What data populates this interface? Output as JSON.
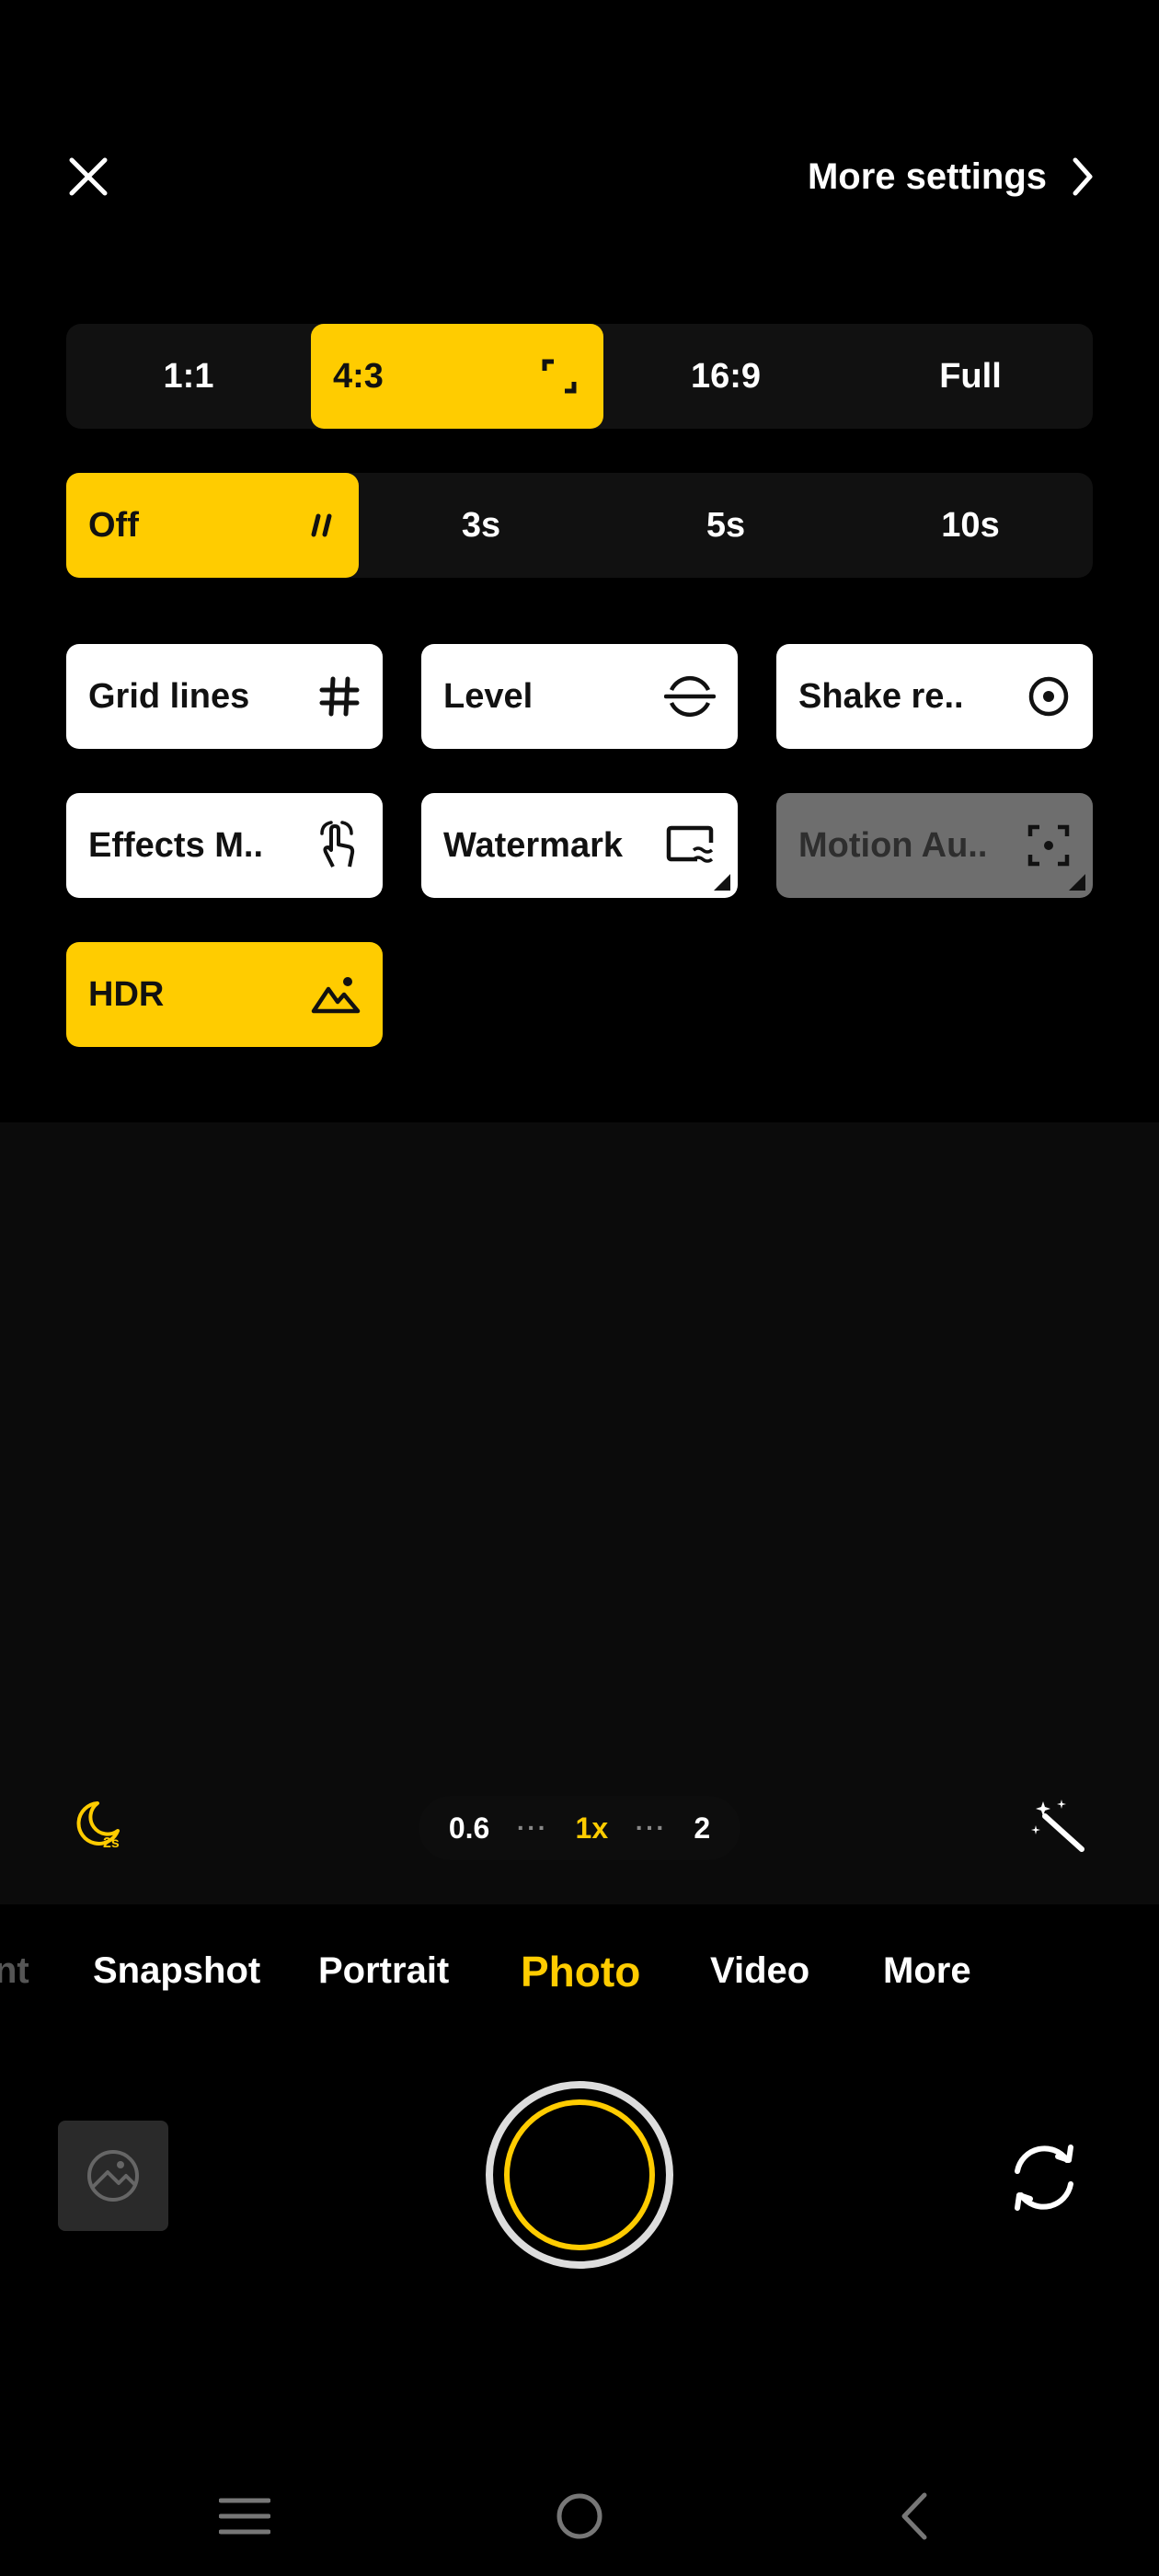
{
  "header": {
    "close_icon": "close-icon",
    "more_settings_label": "More settings",
    "chevron_icon": "chevron-right-icon"
  },
  "aspect_ratio": {
    "options": [
      "1:1",
      "4:3",
      "16:9",
      "Full"
    ],
    "selected": "4:3"
  },
  "timer": {
    "options": [
      "Off",
      "3s",
      "5s",
      "10s"
    ],
    "selected": "Off"
  },
  "toggles": [
    {
      "label": "Grid lines",
      "icon": "grid-icon",
      "state": "off"
    },
    {
      "label": "Level",
      "icon": "level-icon",
      "state": "off"
    },
    {
      "label": "Shake re..",
      "icon": "shake-reduction-icon",
      "state": "off"
    },
    {
      "label": "Effects M..",
      "icon": "gesture-icon",
      "state": "off"
    },
    {
      "label": "Watermark",
      "icon": "watermark-icon",
      "state": "off"
    },
    {
      "label": "Motion Au..",
      "icon": "motion-autofocus-icon",
      "state": "disabled"
    },
    {
      "label": "HDR",
      "icon": "hdr-mountain-icon",
      "state": "on"
    }
  ],
  "zoom": {
    "levels": [
      "0.6",
      "1x",
      "2"
    ],
    "selected": "1x",
    "night_icon": "night-mode-icon",
    "night_label": "2s",
    "magic_icon": "magic-wand-icon"
  },
  "modes": {
    "items": [
      "nt",
      "Snapshot",
      "Portrait",
      "Photo",
      "Video",
      "More"
    ],
    "selected": "Photo"
  },
  "controls": {
    "gallery_icon": "gallery-icon",
    "shutter_icon": "shutter-button",
    "flip_icon": "flip-camera-icon"
  },
  "navbar": {
    "menu_icon": "menu-icon",
    "home_icon": "home-icon",
    "back_icon": "back-icon"
  },
  "colors": {
    "accent": "#FFCC00",
    "background": "#000000",
    "tile": "#FFFFFF",
    "tile_disabled": "#6E6E6E"
  }
}
